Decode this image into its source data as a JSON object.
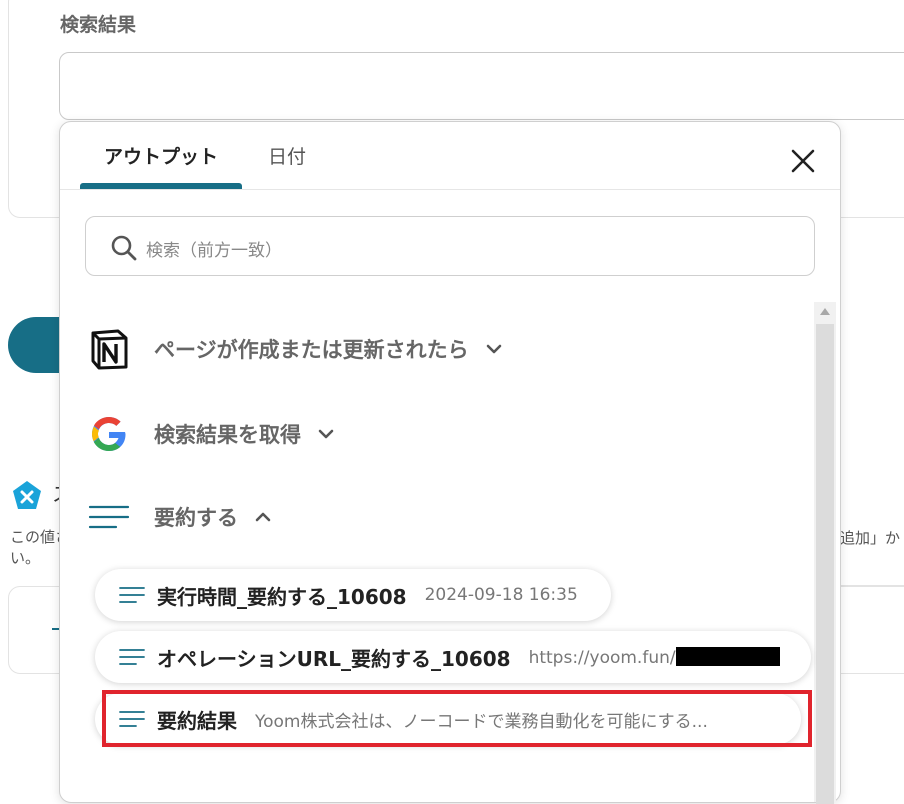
{
  "background": {
    "field_label": "検索結果",
    "title_fragment": "ス",
    "note_left": "この値さい。",
    "note_right": "追加」か"
  },
  "popover": {
    "tabs": [
      {
        "label": "アウトプット",
        "active": true
      },
      {
        "label": "日付",
        "active": false
      }
    ],
    "search": {
      "placeholder": "検索（前方一致）"
    },
    "sections": [
      {
        "title": "ページが作成または更新されたら",
        "icon": "notion-icon",
        "expanded": false
      },
      {
        "title": "検索結果を取得",
        "icon": "google-icon",
        "expanded": false
      },
      {
        "title": "要約する",
        "icon": "lines-icon",
        "expanded": true
      }
    ],
    "items": [
      {
        "label": "実行時間_要約する_10608",
        "value": "2024-09-18 16:35"
      },
      {
        "label": "オペレーションURL_要約する_10608",
        "value": "https://yoom.fun/"
      },
      {
        "label": "要約結果",
        "value": "Yoom株式会社は、ノーコードで業務自動化を可能にする...",
        "highlighted": true
      }
    ]
  },
  "colors": {
    "accent": "#176e86",
    "highlight": "#e0242d"
  }
}
